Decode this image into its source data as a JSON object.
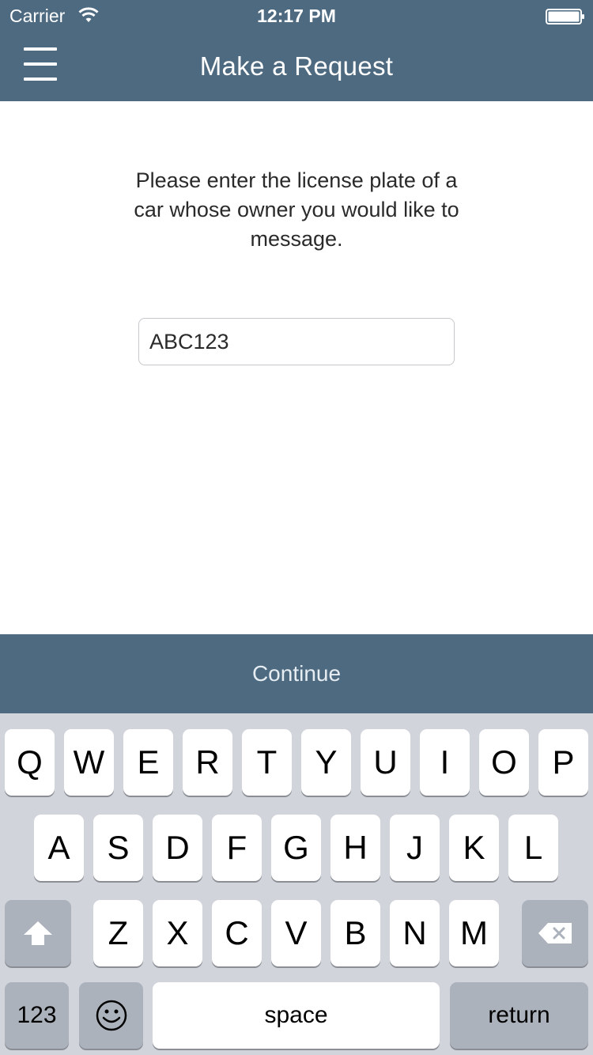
{
  "status_bar": {
    "carrier": "Carrier",
    "time": "12:17 PM"
  },
  "nav": {
    "title": "Make a Request",
    "menu_icon": "hamburger-menu-icon"
  },
  "content": {
    "instructions": "Please enter the license plate of a car whose owner you would like to message.",
    "plate_value": "ABC123"
  },
  "continue": {
    "label": "Continue"
  },
  "keyboard": {
    "row1": [
      "Q",
      "W",
      "E",
      "R",
      "T",
      "Y",
      "U",
      "I",
      "O",
      "P"
    ],
    "row2": [
      "A",
      "S",
      "D",
      "F",
      "G",
      "H",
      "J",
      "K",
      "L"
    ],
    "row3": [
      "Z",
      "X",
      "C",
      "V",
      "B",
      "N",
      "M"
    ],
    "numbers_label": "123",
    "space_label": "space",
    "return_label": "return"
  },
  "colors": {
    "header": "#4e6a80",
    "keyboard": "#d1d5db",
    "dark_key": "#abb2bc"
  }
}
